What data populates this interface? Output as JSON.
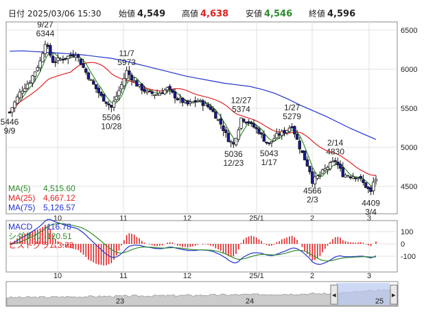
{
  "header": {
    "date_label": "日付",
    "datetime": "2025/03/06 15:30",
    "open_label": "始値",
    "open": "4,549",
    "high_label": "高値",
    "high": "4,638",
    "low_label": "安値",
    "low": "4,546",
    "close_label": "終値",
    "close": "4,596"
  },
  "colors": {
    "up": "#ffffff",
    "down": "#1a1a9a",
    "ma5": "#2e8b2e",
    "ma25": "#e02020",
    "ma75": "#2030d0",
    "macd": "#2030d0",
    "signal": "#2e8b2e",
    "hist": "#e02020",
    "high": "#e02020",
    "low": "#2e8b2e"
  },
  "legend": {
    "ma5_label": "MA(5)",
    "ma5": "4,515.60",
    "ma25_label": "MA(25)",
    "ma25": "4,667.12",
    "ma75_label": "MA(75)",
    "ma75": "5,126.57",
    "macd_label": "MACD",
    "macd": "-116.78",
    "signal_label": "シグナル",
    "signal": "-120.51",
    "hist_label": "ヒストグラム",
    "hist": "3.73"
  },
  "chart_data": {
    "type": "candlestick",
    "price_axis": {
      "ticks": [
        4500,
        5000,
        5500,
        6000,
        6500
      ]
    },
    "macd_axis": {
      "ticks": [
        100,
        0,
        -100
      ]
    },
    "x_labels": [
      "10",
      "11",
      "12",
      "25/1",
      "2",
      "3"
    ],
    "annotations": [
      {
        "date": "9/27",
        "value": "6344",
        "side": "high"
      },
      {
        "date": "11/7",
        "value": "5973",
        "side": "high"
      },
      {
        "date": "12/27",
        "value": "5374",
        "side": "high"
      },
      {
        "date": "1/27",
        "value": "5279",
        "side": "high"
      },
      {
        "date": "2/14",
        "value": "4830",
        "side": "high"
      },
      {
        "date": "9/9",
        "value": "5446",
        "side": "low"
      },
      {
        "date": "10/28",
        "value": "5506",
        "side": "low"
      },
      {
        "date": "12/23",
        "value": "5036",
        "side": "low"
      },
      {
        "date": "1/17",
        "value": "5043",
        "side": "low"
      },
      {
        "date": "2/3",
        "value": "4566",
        "side": "low"
      },
      {
        "date": "3/4",
        "value": "4409",
        "side": "low"
      }
    ],
    "ma75": [
      6230,
      6235,
      6225,
      6215,
      6205,
      6195,
      6180,
      6160,
      6140,
      6110,
      6070,
      6030,
      5990,
      5950,
      5910,
      5880,
      5850,
      5820,
      5800,
      5780,
      5740,
      5690,
      5620,
      5540,
      5470,
      5400,
      5320,
      5240,
      5170,
      5100
    ],
    "overview": {
      "labels": [
        "23",
        "24",
        "25"
      ]
    }
  }
}
